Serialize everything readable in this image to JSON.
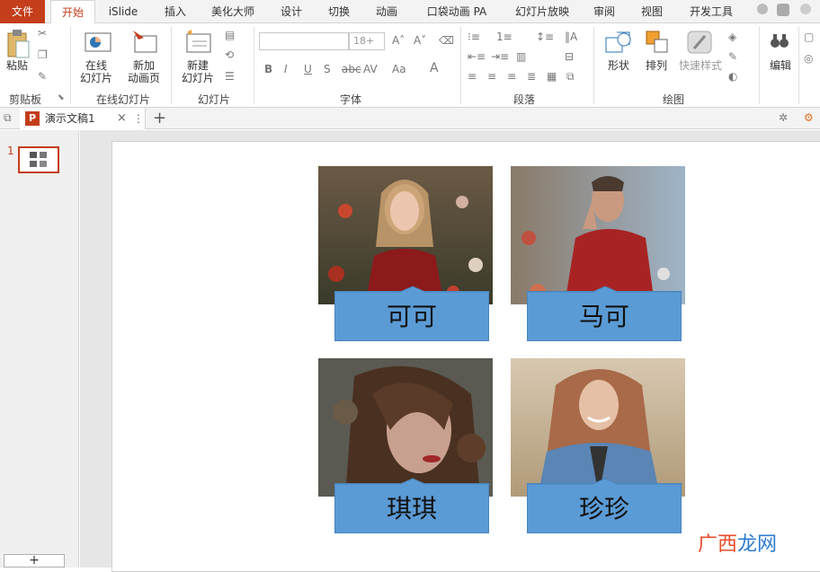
{
  "tabs": [
    {
      "label": "文件"
    },
    {
      "label": "开始"
    },
    {
      "label": "iSlide"
    },
    {
      "label": "插入"
    },
    {
      "label": "美化大师"
    },
    {
      "label": "设计"
    },
    {
      "label": "切换"
    },
    {
      "label": "动画"
    },
    {
      "label": "口袋动画 PA"
    },
    {
      "label": "幻灯片放映"
    },
    {
      "label": "审阅"
    },
    {
      "label": "视图"
    },
    {
      "label": "开发工具"
    }
  ],
  "ribbon": {
    "paste_label": "粘贴",
    "clipboard_group": "剪贴板",
    "online_slide_label_1": "在线",
    "online_slide_label_2": "幻灯片",
    "add_anim_label_1": "新加",
    "add_anim_label_2": "动画页",
    "online_group": "在线幻灯片",
    "new_slide_label_1": "新建",
    "new_slide_label_2": "幻灯片",
    "slides_group": "幻灯片",
    "font_size": "18+",
    "font_group": "字体",
    "paragraph_group": "段落",
    "shape_label": "形状",
    "arrange_label": "排列",
    "quick_style_label": "快速样式",
    "drawing_group": "绘图",
    "edit_label": "编辑"
  },
  "document": {
    "tab_name": "演示文稿1",
    "add_tab": "+"
  },
  "thumbnails": [
    {
      "number": "1"
    }
  ],
  "slide": {
    "cards": [
      {
        "name": "可可"
      },
      {
        "name": "马可"
      },
      {
        "name": "琪琪"
      },
      {
        "name": "珍珍"
      }
    ]
  },
  "leftpane": {
    "add_button": "+"
  },
  "watermark": {
    "part1": "广西",
    "part2": "龙网"
  },
  "colors": {
    "accent": "#c43e1c",
    "label_fill": "#5b9bd5",
    "watermark_red": "#e94b2b",
    "watermark_blue": "#2c7bd0"
  }
}
